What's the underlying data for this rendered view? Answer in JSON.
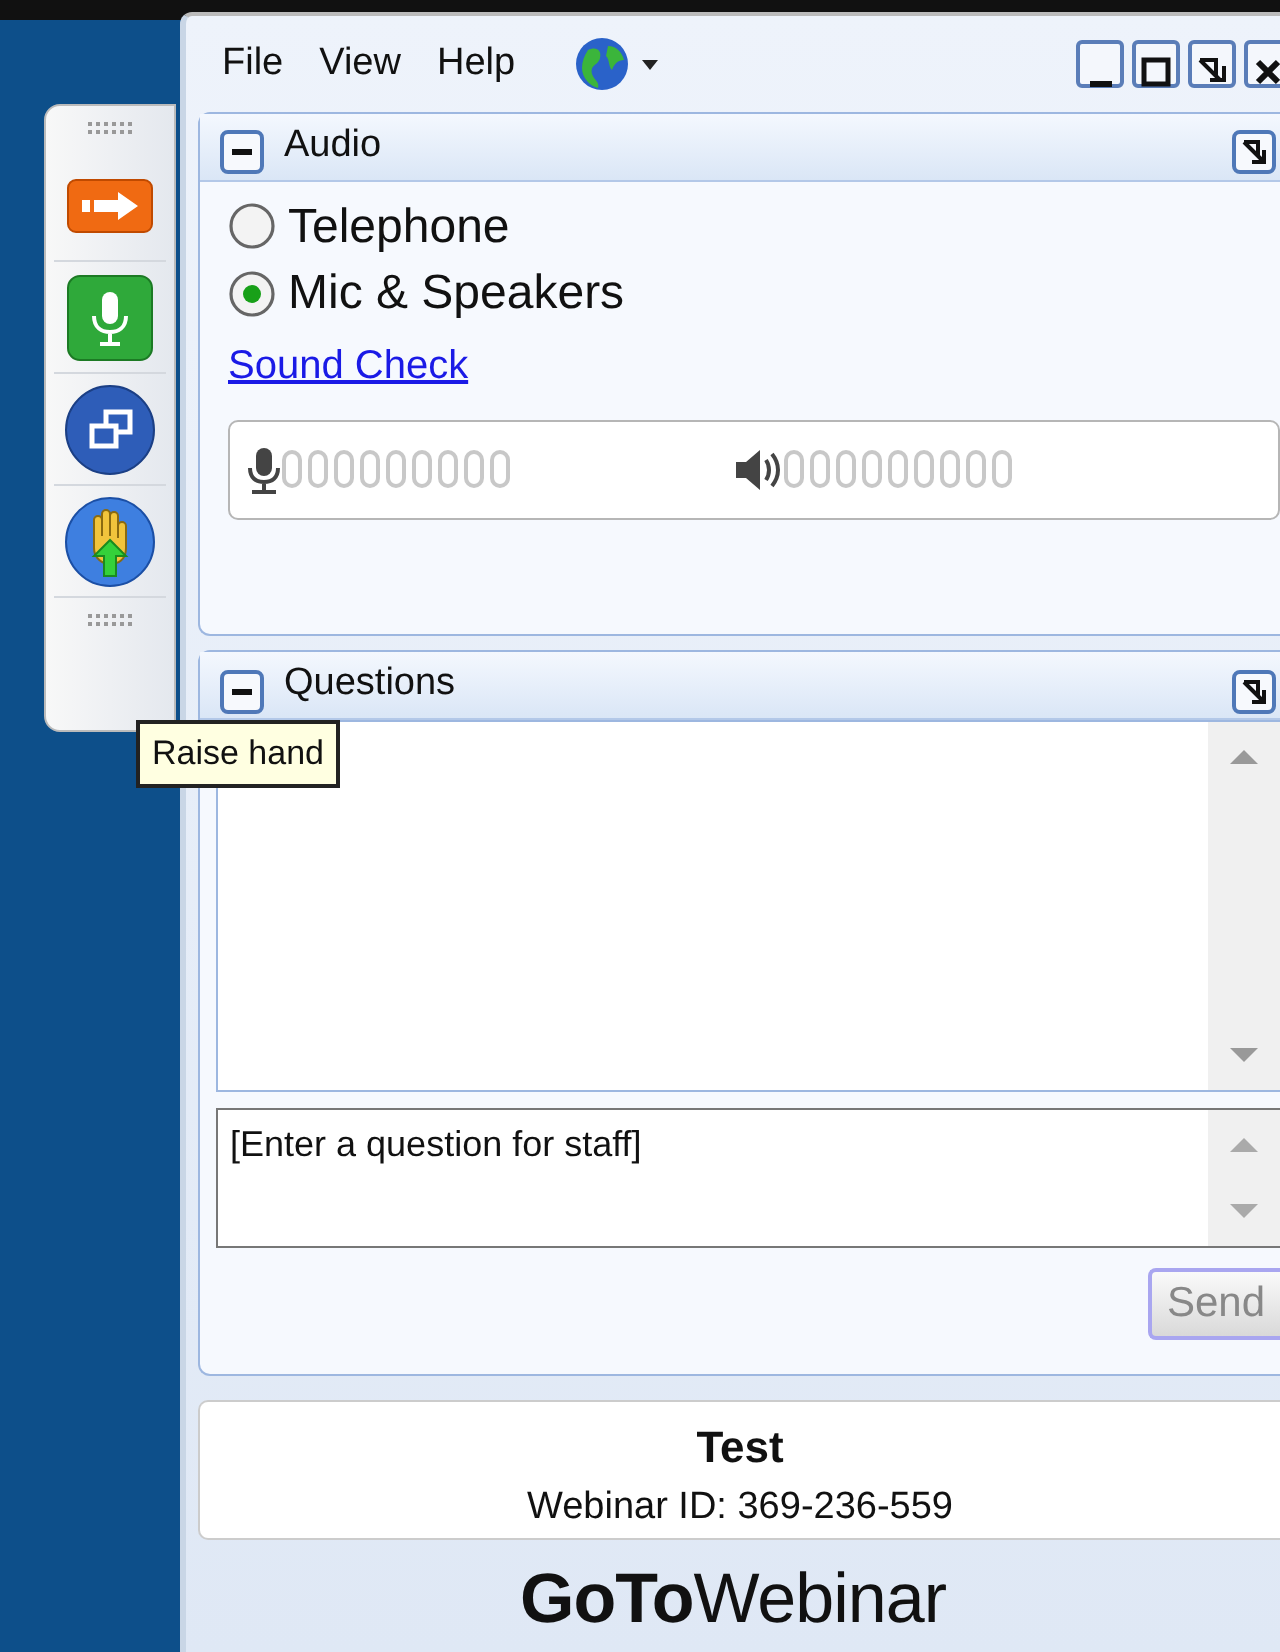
{
  "menu": [
    {
      "label": "File"
    },
    {
      "label": "View"
    },
    {
      "label": "Help"
    }
  ],
  "toolbar": [
    {
      "kind": "arrow"
    },
    {
      "kind": "mic"
    },
    {
      "kind": "window"
    },
    {
      "kind": "hand"
    }
  ],
  "tooltip": "Raise hand",
  "audio": {
    "title": "Audio",
    "options": [
      {
        "label": "Telephone",
        "selected": false
      },
      {
        "label": "Mic & Speakers",
        "selected": true
      }
    ],
    "link": "Sound Check",
    "meters": [
      {
        "kind": "mic",
        "level": 0
      },
      {
        "kind": "speaker",
        "level": 0
      }
    ]
  },
  "questions": {
    "title": "Questions",
    "input": {
      "placeholder": "[Enter a question for staff]"
    },
    "send": {
      "label": "Send",
      "disabled": true
    }
  },
  "webinar": {
    "title": "Test",
    "id_line": "Webinar ID: 369-236-559"
  },
  "brand": "**GoTo**Webinar"
}
